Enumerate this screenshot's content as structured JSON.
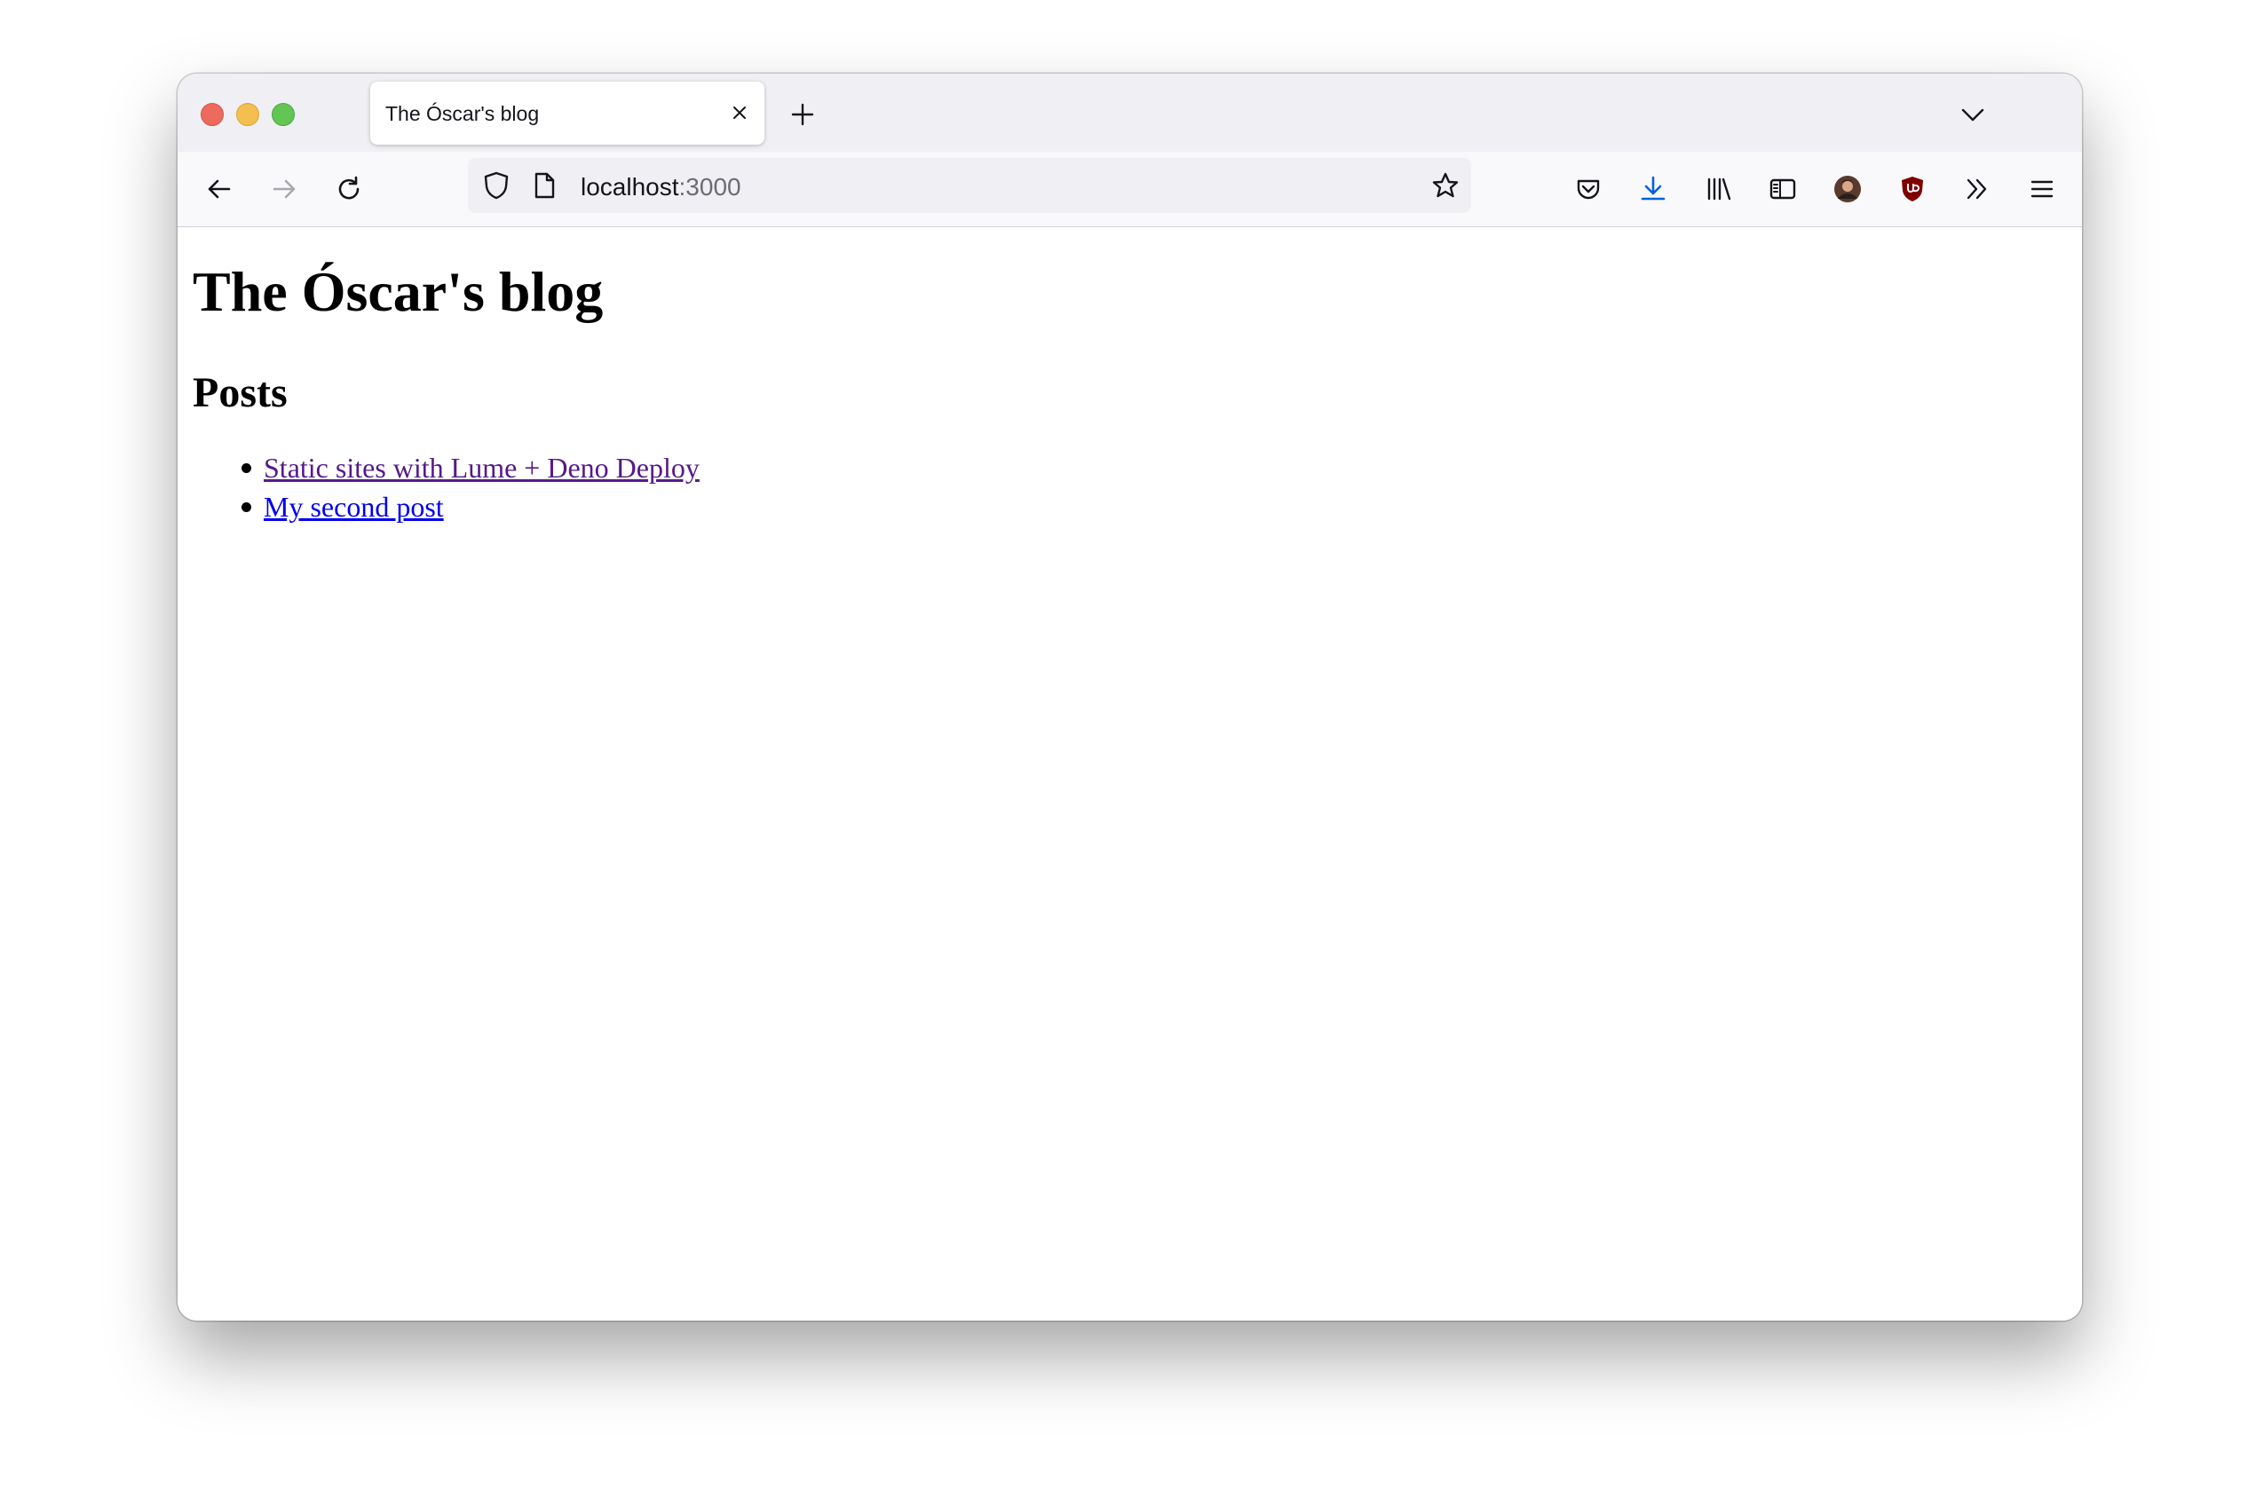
{
  "browser": {
    "tab": {
      "title": "The Óscar's blog"
    },
    "url": {
      "host": "localhost",
      "port": ":3000"
    }
  },
  "page": {
    "heading": "The Óscar's blog",
    "section_heading": "Posts",
    "posts": [
      {
        "label": "Static sites with Lume + Deno Deploy",
        "visited": true
      },
      {
        "label": "My second post",
        "visited": false
      }
    ]
  },
  "colors": {
    "chrome_bg": "#f0f0f4",
    "visited_link": "#551a8b",
    "unvisited_link": "#0000ee",
    "download_accent": "#0061e0",
    "ublock_red": "#800000"
  }
}
